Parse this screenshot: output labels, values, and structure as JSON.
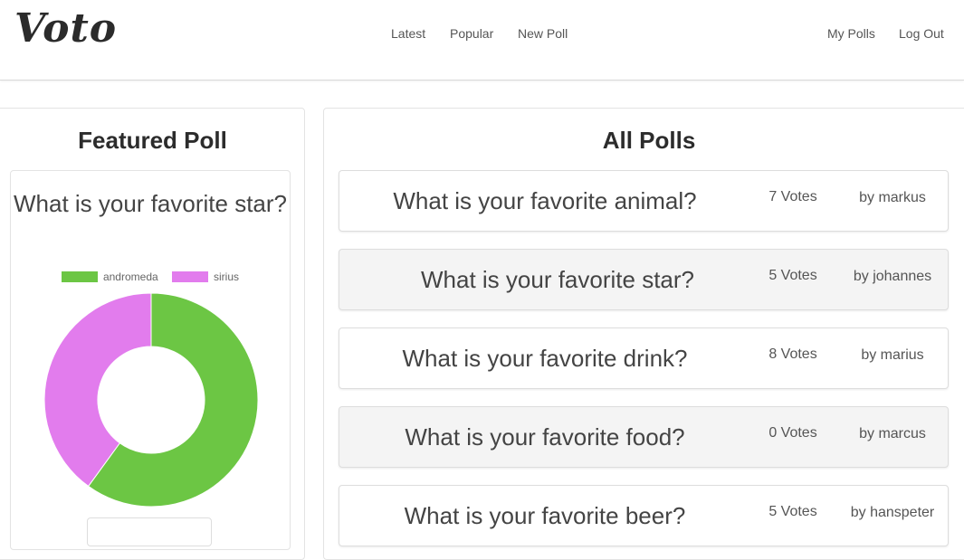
{
  "app": {
    "logo": "Voto"
  },
  "nav": {
    "latest": "Latest",
    "popular": "Popular",
    "new_poll": "New Poll",
    "my_polls": "My Polls",
    "log_out": "Log Out"
  },
  "featured": {
    "heading": "Featured Poll",
    "question": "What is your favorite star?",
    "chart_data": {
      "type": "pie",
      "variant": "doughnut",
      "labels": [
        "andromeda",
        "sirius"
      ],
      "values": [
        3,
        2
      ],
      "colors": [
        "#6cc644",
        "#e27ced"
      ],
      "legend": "top"
    }
  },
  "all_polls": {
    "heading": "All Polls",
    "polls": [
      {
        "question": "What is your favorite animal?",
        "votes": "7 Votes",
        "author": "by markus"
      },
      {
        "question": "What is your favorite star?",
        "votes": "5 Votes",
        "author": "by johannes"
      },
      {
        "question": "What is your favorite drink?",
        "votes": "8 Votes",
        "author": "by marius"
      },
      {
        "question": "What is your favorite food?",
        "votes": "0 Votes",
        "author": "by marcus"
      },
      {
        "question": "What is your favorite beer?",
        "votes": "5 Votes",
        "author": "by hanspeter"
      }
    ]
  }
}
